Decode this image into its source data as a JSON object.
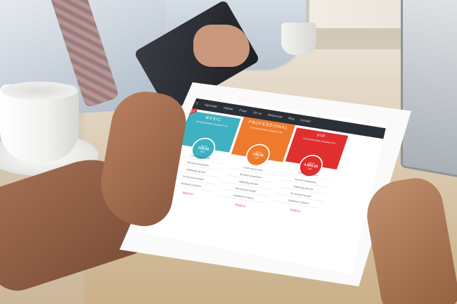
{
  "navbar": {
    "logo": "S",
    "items": [
      "Hjemside",
      "Ydelser",
      "Priser",
      "Om os",
      "Referencer",
      "Blog",
      "Kontakt"
    ]
  },
  "plans": [
    {
      "name": "BASIC",
      "desc": "Kort beskrivelse af pakken her",
      "price_small": "pris pr.",
      "price_big": "128,00",
      "price_unit": "DKK",
      "features": [
        "Lorem ipsum dolor",
        "Sit amet consectetur",
        "Adipiscing elit sed",
        "Do eiusmod tempor",
        "Incididunt ut labore"
      ],
      "signup": "Bestil nu"
    },
    {
      "name": "PROFESSIONAL",
      "desc": "Kort beskrivelse af pakken her",
      "price_small": "pris pr.",
      "price_big": "148,00",
      "price_unit": "DKK",
      "features": [
        "Lorem ipsum dolor",
        "Sit amet consectetur",
        "Adipiscing elit sed",
        "Do eiusmod tempor",
        "Incididunt ut labore"
      ],
      "signup": "Bestil nu"
    },
    {
      "name": "VIP",
      "desc": "Kort beskrivelse af pakken her",
      "price_small": "pris pr.",
      "price_big": "4.850,00",
      "price_unit": "DKK",
      "features": [
        "Lorem ipsum dolor",
        "Sit amet consectetur",
        "Adipiscing elit sed",
        "Do eiusmod tempor",
        "Incididunt ut labore"
      ],
      "signup": "Bestil nu"
    }
  ],
  "colors": {
    "basic": "#3fb1c1",
    "professional": "#ee7a2d",
    "vip": "#e02f2f",
    "navbar": "#2b2f36"
  }
}
